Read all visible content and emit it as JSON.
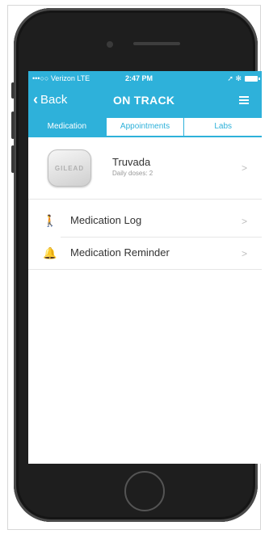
{
  "status_bar": {
    "carrier": "•••○○ Verizon  LTE",
    "time": "2:47 PM",
    "right_icons": "➚ ✻"
  },
  "nav": {
    "back_label": "Back",
    "title": "ON TRACK"
  },
  "tabs": [
    {
      "label": "Medication",
      "active": true
    },
    {
      "label": "Appointments",
      "active": false
    },
    {
      "label": "Labs",
      "active": false
    }
  ],
  "medication": {
    "name": "Truvada",
    "doses": "Daily doses: 2",
    "pill_imprint": "GILEAD"
  },
  "list": [
    {
      "label": "Medication Log",
      "icon": "person-icon"
    },
    {
      "label": "Medication Reminder",
      "icon": "bell-icon"
    }
  ],
  "chevron": ">",
  "colors": {
    "accent": "#2eb1da",
    "phone_body": "#1e1e1e"
  }
}
